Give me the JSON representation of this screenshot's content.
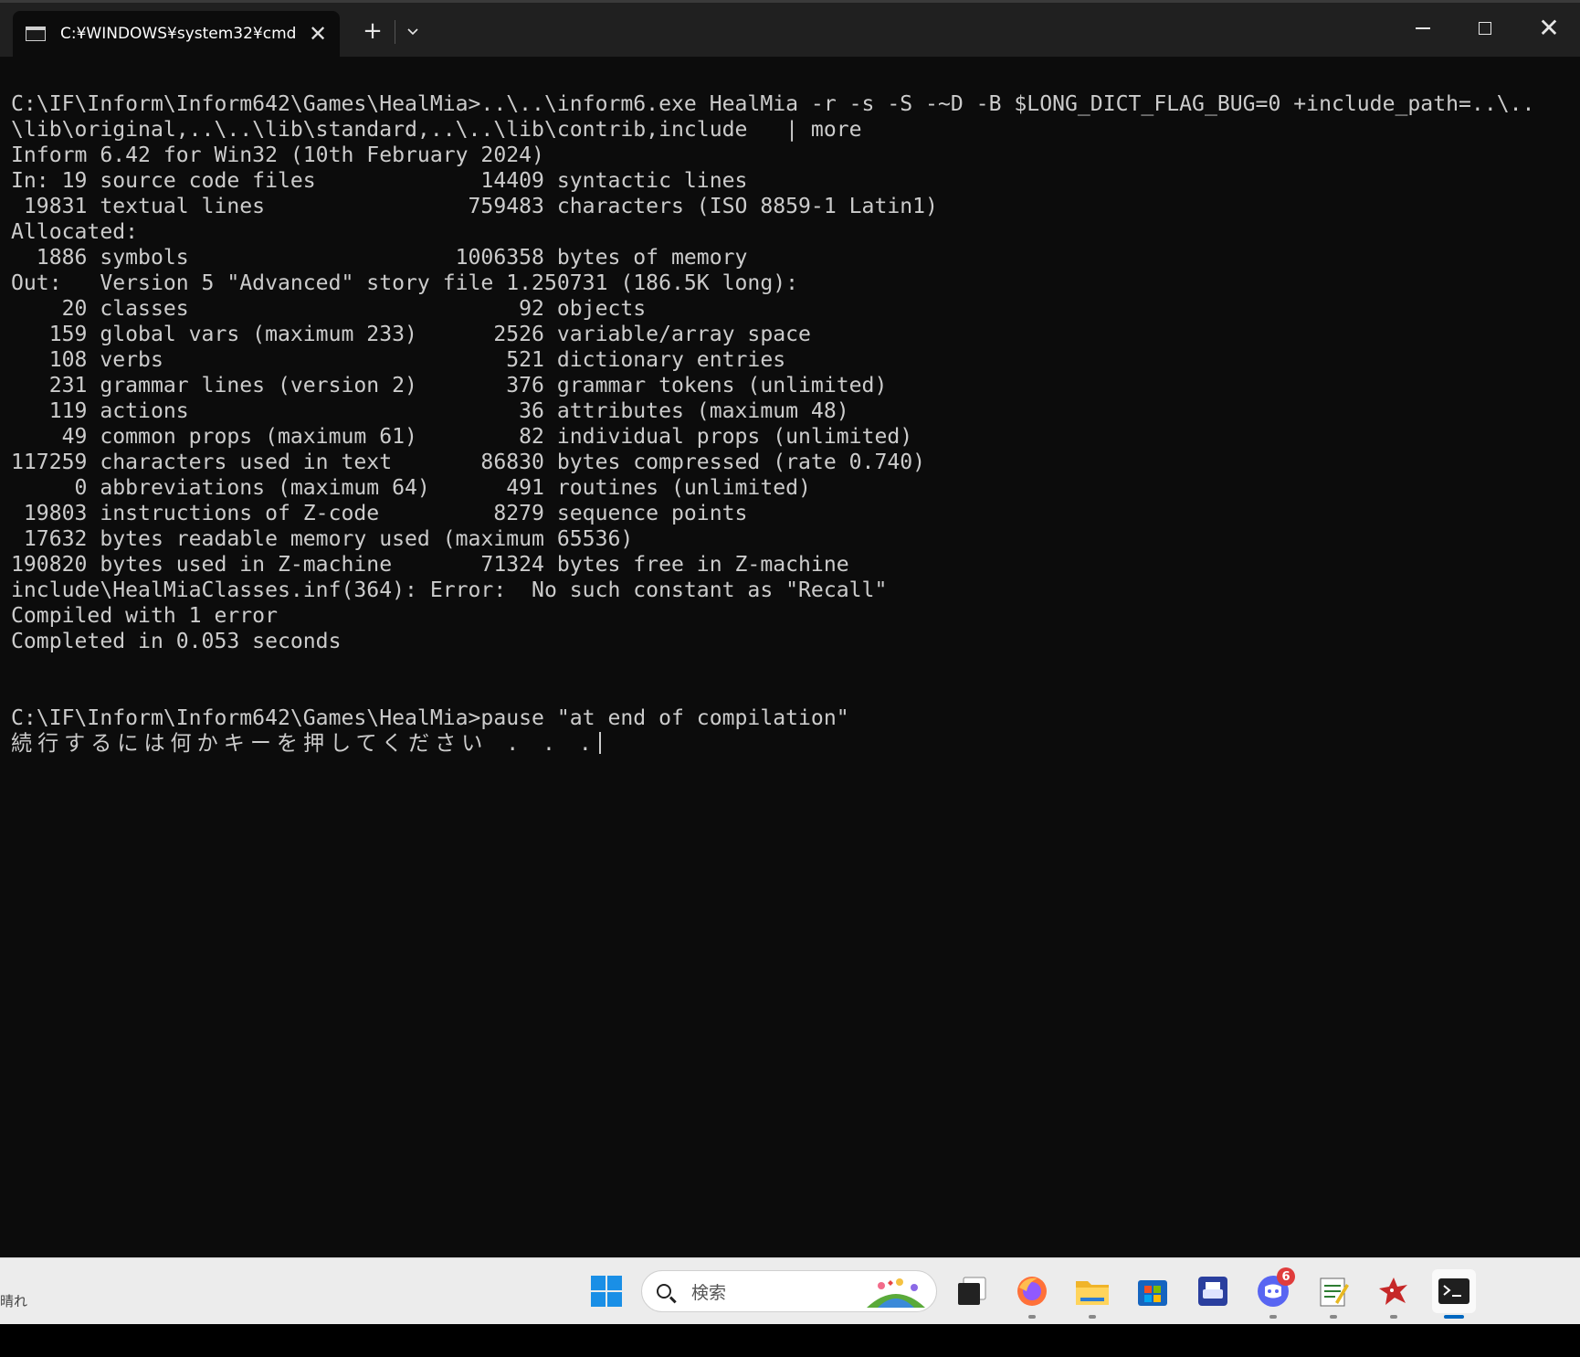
{
  "window": {
    "tab_title": "C:¥WINDOWS¥system32¥cmd",
    "tab_close_glyph": "✕",
    "new_tab_glyph": "+",
    "dropdown_glyph": "⌄",
    "close_glyph": "✕"
  },
  "terminal": {
    "lines": [
      "C:\\IF\\Inform\\Inform642\\Games\\HealMia>..\\..\\inform6.exe HealMia -r -s -S -~D -B $LONG_DICT_FLAG_BUG=0 +include_path=..\\..",
      "\\lib\\original,..\\..\\lib\\standard,..\\..\\lib\\contrib,include   | more",
      "Inform 6.42 for Win32 (10th February 2024)",
      "In: 19 source code files             14409 syntactic lines",
      " 19831 textual lines                759483 characters (ISO 8859-1 Latin1)",
      "Allocated:",
      "  1886 symbols                     1006358 bytes of memory",
      "Out:   Version 5 \"Advanced\" story file 1.250731 (186.5K long):",
      "    20 classes                          92 objects",
      "   159 global vars (maximum 233)      2526 variable/array space",
      "   108 verbs                           521 dictionary entries",
      "   231 grammar lines (version 2)       376 grammar tokens (unlimited)",
      "   119 actions                          36 attributes (maximum 48)",
      "    49 common props (maximum 61)        82 individual props (unlimited)",
      "117259 characters used in text       86830 bytes compressed (rate 0.740)",
      "     0 abbreviations (maximum 64)      491 routines (unlimited)",
      " 19803 instructions of Z-code         8279 sequence points",
      " 17632 bytes readable memory used (maximum 65536)",
      "190820 bytes used in Z-machine       71324 bytes free in Z-machine",
      "include\\HealMiaClasses.inf(364): Error:  No such constant as \"Recall\"",
      "Compiled with 1 error",
      "Completed in 0.053 seconds",
      "",
      "",
      "C:\\IF\\Inform\\Inform642\\Games\\HealMia>pause \"at end of compilation\""
    ],
    "prompt_line": "続行するには何かキーを押してください . . ."
  },
  "taskbar": {
    "weather_text": "晴れ",
    "search_placeholder": "検索",
    "discord_badge": "6",
    "accent": "#0067c0"
  }
}
